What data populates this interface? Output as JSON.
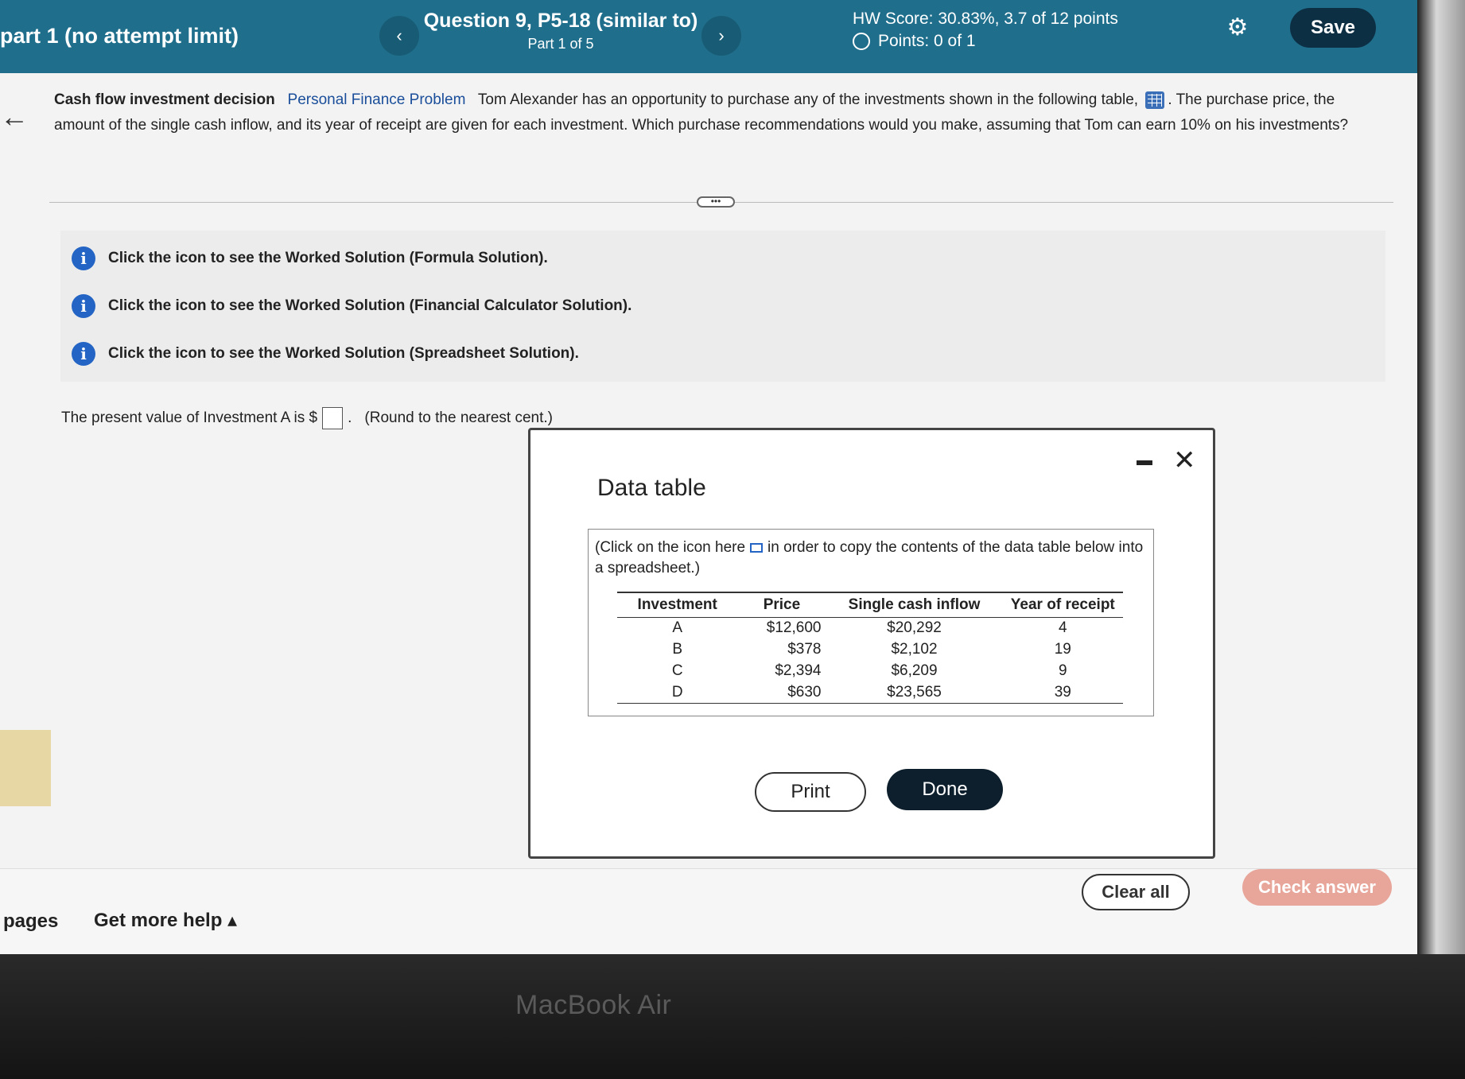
{
  "header": {
    "assignment": "part 1 (no attempt limit)",
    "prev_icon": "‹",
    "next_icon": "›",
    "question_title": "Question 9, P5-18 (similar to)",
    "question_part": "Part 1 of 5",
    "hw_score": "HW Score: 30.83%, 3.7 of 12 points",
    "points": "Points: 0 of 1",
    "gear_icon": "⚙",
    "save_label": "Save"
  },
  "problem": {
    "title": "Cash flow investment decision",
    "category": "Personal Finance Problem",
    "text_before_icon": "Tom Alexander has an opportunity to purchase any of the investments shown in the following table,",
    "text_after_icon": ". The purchase price, the amount of the single cash inflow, and its year of receipt are given for each investment.  Which purchase recommendations would you make, assuming that Tom can earn 10% on his investments?"
  },
  "expander": "•••",
  "solutions": [
    "Click the icon to see the Worked Solution (Formula Solution).",
    "Click the icon to see the Worked Solution (Financial Calculator Solution).",
    "Click the icon to see the Worked Solution (Spreadsheet Solution)."
  ],
  "present_value": {
    "prefix": "The present value of Investment A is $",
    "suffix": ".",
    "hint": "(Round to the nearest cent.)"
  },
  "modal": {
    "title": "Data table",
    "copy_note_before": "(Click on the icon here",
    "copy_note_after": "in order to copy the contents of the data table below into a spreadsheet.)",
    "headers": [
      "Investment",
      "Price",
      "Single cash inflow",
      "Year of receipt"
    ],
    "rows": [
      [
        "A",
        "$12,600",
        "$20,292",
        "4"
      ],
      [
        "B",
        "$378",
        "$2,102",
        "19"
      ],
      [
        "C",
        "$2,394",
        "$6,209",
        "9"
      ],
      [
        "D",
        "$630",
        "$23,565",
        "39"
      ]
    ],
    "print_label": "Print",
    "done_label": "Done"
  },
  "footer": {
    "pages": "pages",
    "get_help": "Get more help ▴",
    "clear_all": "Clear all",
    "check_answer": "Check answer"
  },
  "device_label": "MacBook Air"
}
